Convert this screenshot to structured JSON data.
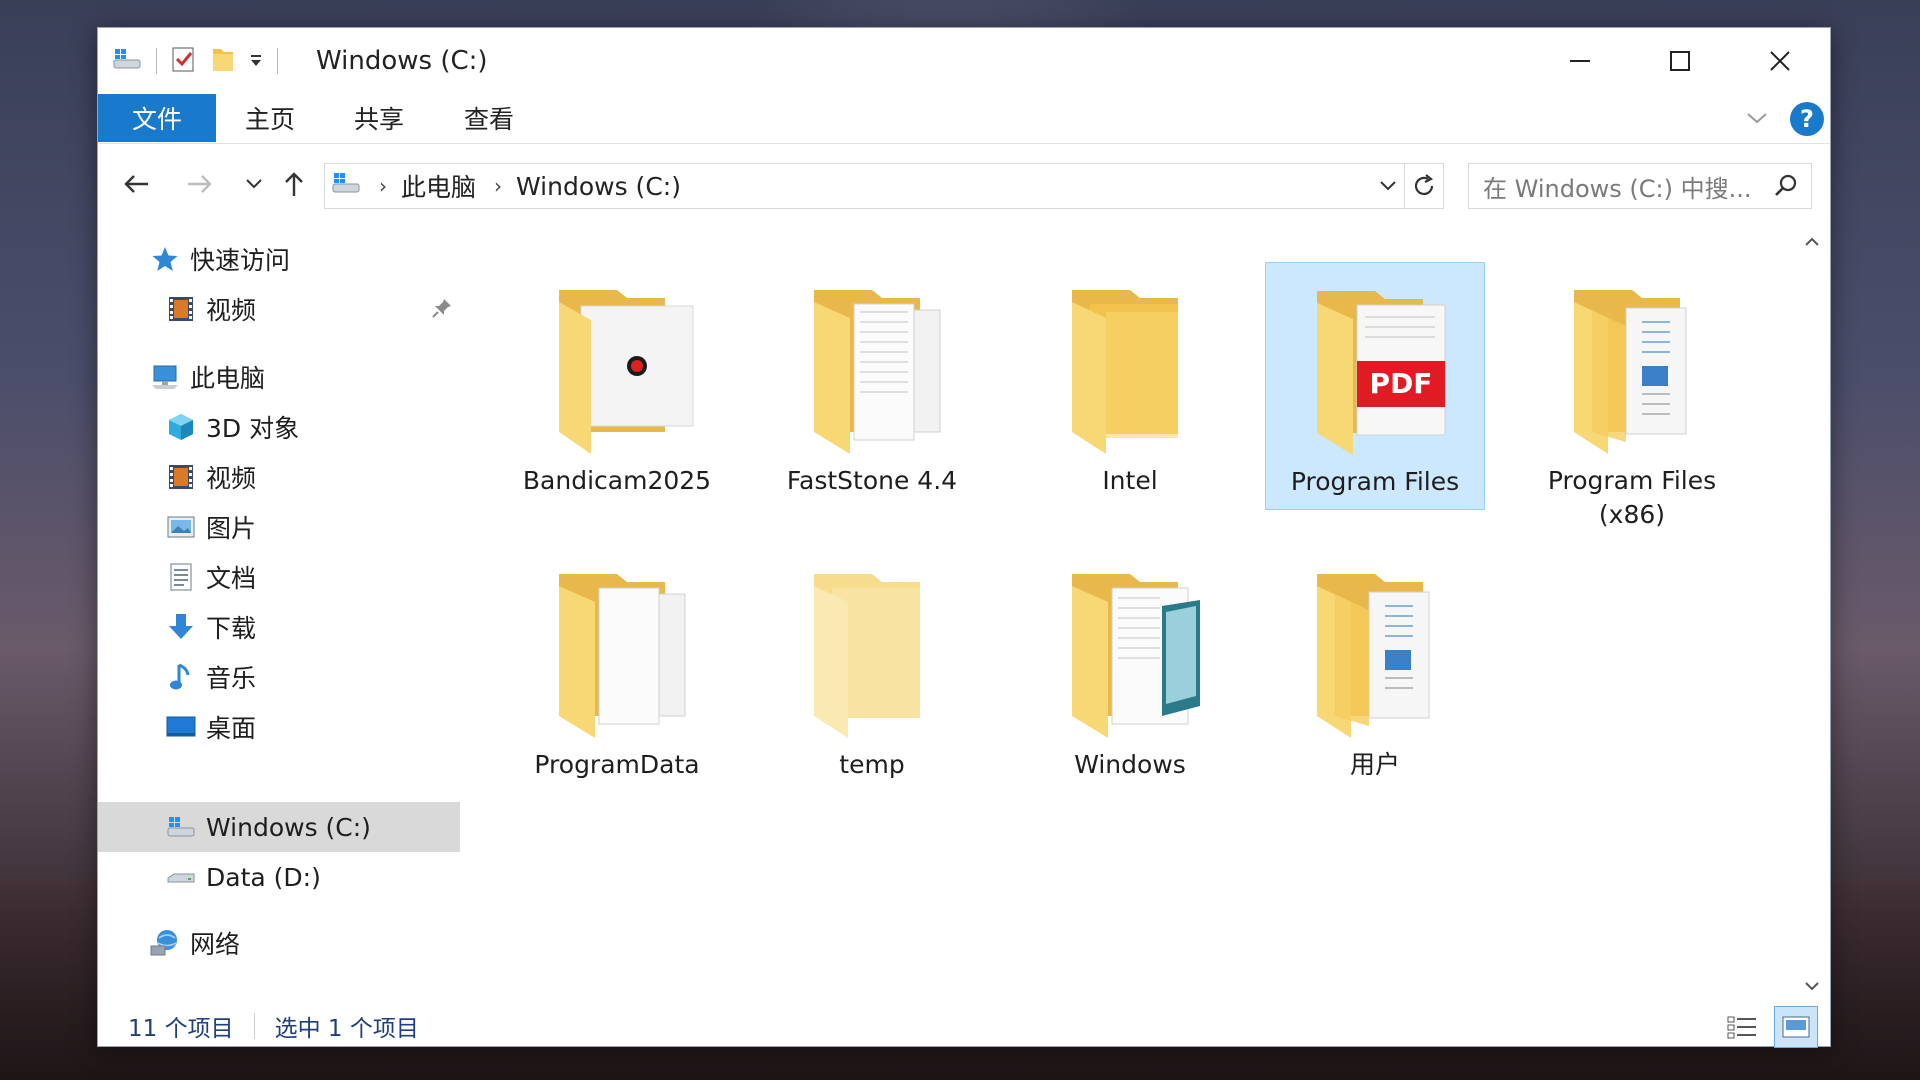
{
  "window": {
    "title": "Windows (C:)"
  },
  "ribbon": {
    "tabs": [
      "文件",
      "主页",
      "共享",
      "查看"
    ],
    "active_tab": "文件",
    "help_label": "?"
  },
  "address": {
    "crumbs": [
      "此电脑",
      "Windows (C:)"
    ],
    "search_placeholder": "在 Windows (C:) 中搜..."
  },
  "sidebar": {
    "items": [
      {
        "label": "快速访问",
        "icon": "star-icon"
      },
      {
        "label": "视频",
        "icon": "video-icon",
        "pinned": true
      },
      {
        "label": "此电脑",
        "icon": "computer-icon"
      },
      {
        "label": "3D 对象",
        "icon": "cube-icon"
      },
      {
        "label": "视频",
        "icon": "video-icon"
      },
      {
        "label": "图片",
        "icon": "picture-icon"
      },
      {
        "label": "文档",
        "icon": "document-icon"
      },
      {
        "label": "下载",
        "icon": "download-icon"
      },
      {
        "label": "音乐",
        "icon": "music-icon"
      },
      {
        "label": "桌面",
        "icon": "desktop-icon"
      },
      {
        "label": "Windows (C:)",
        "icon": "windows-drive-icon",
        "selected": true
      },
      {
        "label": "Data (D:)",
        "icon": "drive-icon"
      },
      {
        "label": "网络",
        "icon": "network-icon"
      }
    ]
  },
  "content": {
    "folders": [
      {
        "name": "Bandicam2025",
        "variant": "record"
      },
      {
        "name": "FastStone 4.4",
        "variant": "papers"
      },
      {
        "name": "Intel",
        "variant": "plain"
      },
      {
        "name": "Program Files",
        "variant": "pdf",
        "selected": true,
        "badge": "PDF"
      },
      {
        "name": "Program Files\n(x86)",
        "variant": "docs"
      },
      {
        "name": "ProgramData",
        "variant": "papers"
      },
      {
        "name": "temp",
        "variant": "empty"
      },
      {
        "name": "Windows",
        "variant": "book"
      },
      {
        "name": "用户",
        "variant": "docs"
      }
    ]
  },
  "status": {
    "item_count": "11 个项目",
    "selection": "选中 1 个项目"
  },
  "colors": {
    "accent": "#1979ca",
    "selection_bg": "#cce8ff",
    "selection_border": "#99d1ff",
    "folder_front": "#f8d775",
    "folder_back": "#e8b94a",
    "status_text": "#1e3f7a"
  }
}
